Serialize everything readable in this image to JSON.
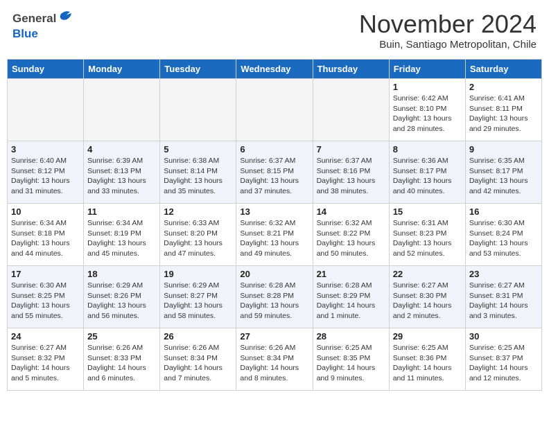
{
  "header": {
    "logo_general": "General",
    "logo_blue": "Blue",
    "month_title": "November 2024",
    "location": "Buin, Santiago Metropolitan, Chile"
  },
  "days_of_week": [
    "Sunday",
    "Monday",
    "Tuesday",
    "Wednesday",
    "Thursday",
    "Friday",
    "Saturday"
  ],
  "weeks": [
    {
      "row_class": "week-row-1",
      "days": [
        {
          "num": "",
          "info": "",
          "empty": true
        },
        {
          "num": "",
          "info": "",
          "empty": true
        },
        {
          "num": "",
          "info": "",
          "empty": true
        },
        {
          "num": "",
          "info": "",
          "empty": true
        },
        {
          "num": "",
          "info": "",
          "empty": true
        },
        {
          "num": "1",
          "info": "Sunrise: 6:42 AM\nSunset: 8:10 PM\nDaylight: 13 hours\nand 28 minutes.",
          "empty": false
        },
        {
          "num": "2",
          "info": "Sunrise: 6:41 AM\nSunset: 8:11 PM\nDaylight: 13 hours\nand 29 minutes.",
          "empty": false
        }
      ]
    },
    {
      "row_class": "week-row-2",
      "days": [
        {
          "num": "3",
          "info": "Sunrise: 6:40 AM\nSunset: 8:12 PM\nDaylight: 13 hours\nand 31 minutes.",
          "empty": false
        },
        {
          "num": "4",
          "info": "Sunrise: 6:39 AM\nSunset: 8:13 PM\nDaylight: 13 hours\nand 33 minutes.",
          "empty": false
        },
        {
          "num": "5",
          "info": "Sunrise: 6:38 AM\nSunset: 8:14 PM\nDaylight: 13 hours\nand 35 minutes.",
          "empty": false
        },
        {
          "num": "6",
          "info": "Sunrise: 6:37 AM\nSunset: 8:15 PM\nDaylight: 13 hours\nand 37 minutes.",
          "empty": false
        },
        {
          "num": "7",
          "info": "Sunrise: 6:37 AM\nSunset: 8:16 PM\nDaylight: 13 hours\nand 38 minutes.",
          "empty": false
        },
        {
          "num": "8",
          "info": "Sunrise: 6:36 AM\nSunset: 8:17 PM\nDaylight: 13 hours\nand 40 minutes.",
          "empty": false
        },
        {
          "num": "9",
          "info": "Sunrise: 6:35 AM\nSunset: 8:17 PM\nDaylight: 13 hours\nand 42 minutes.",
          "empty": false
        }
      ]
    },
    {
      "row_class": "week-row-3",
      "days": [
        {
          "num": "10",
          "info": "Sunrise: 6:34 AM\nSunset: 8:18 PM\nDaylight: 13 hours\nand 44 minutes.",
          "empty": false
        },
        {
          "num": "11",
          "info": "Sunrise: 6:34 AM\nSunset: 8:19 PM\nDaylight: 13 hours\nand 45 minutes.",
          "empty": false
        },
        {
          "num": "12",
          "info": "Sunrise: 6:33 AM\nSunset: 8:20 PM\nDaylight: 13 hours\nand 47 minutes.",
          "empty": false
        },
        {
          "num": "13",
          "info": "Sunrise: 6:32 AM\nSunset: 8:21 PM\nDaylight: 13 hours\nand 49 minutes.",
          "empty": false
        },
        {
          "num": "14",
          "info": "Sunrise: 6:32 AM\nSunset: 8:22 PM\nDaylight: 13 hours\nand 50 minutes.",
          "empty": false
        },
        {
          "num": "15",
          "info": "Sunrise: 6:31 AM\nSunset: 8:23 PM\nDaylight: 13 hours\nand 52 minutes.",
          "empty": false
        },
        {
          "num": "16",
          "info": "Sunrise: 6:30 AM\nSunset: 8:24 PM\nDaylight: 13 hours\nand 53 minutes.",
          "empty": false
        }
      ]
    },
    {
      "row_class": "week-row-4",
      "days": [
        {
          "num": "17",
          "info": "Sunrise: 6:30 AM\nSunset: 8:25 PM\nDaylight: 13 hours\nand 55 minutes.",
          "empty": false
        },
        {
          "num": "18",
          "info": "Sunrise: 6:29 AM\nSunset: 8:26 PM\nDaylight: 13 hours\nand 56 minutes.",
          "empty": false
        },
        {
          "num": "19",
          "info": "Sunrise: 6:29 AM\nSunset: 8:27 PM\nDaylight: 13 hours\nand 58 minutes.",
          "empty": false
        },
        {
          "num": "20",
          "info": "Sunrise: 6:28 AM\nSunset: 8:28 PM\nDaylight: 13 hours\nand 59 minutes.",
          "empty": false
        },
        {
          "num": "21",
          "info": "Sunrise: 6:28 AM\nSunset: 8:29 PM\nDaylight: 14 hours\nand 1 minute.",
          "empty": false
        },
        {
          "num": "22",
          "info": "Sunrise: 6:27 AM\nSunset: 8:30 PM\nDaylight: 14 hours\nand 2 minutes.",
          "empty": false
        },
        {
          "num": "23",
          "info": "Sunrise: 6:27 AM\nSunset: 8:31 PM\nDaylight: 14 hours\nand 3 minutes.",
          "empty": false
        }
      ]
    },
    {
      "row_class": "week-row-5",
      "days": [
        {
          "num": "24",
          "info": "Sunrise: 6:27 AM\nSunset: 8:32 PM\nDaylight: 14 hours\nand 5 minutes.",
          "empty": false
        },
        {
          "num": "25",
          "info": "Sunrise: 6:26 AM\nSunset: 8:33 PM\nDaylight: 14 hours\nand 6 minutes.",
          "empty": false
        },
        {
          "num": "26",
          "info": "Sunrise: 6:26 AM\nSunset: 8:34 PM\nDaylight: 14 hours\nand 7 minutes.",
          "empty": false
        },
        {
          "num": "27",
          "info": "Sunrise: 6:26 AM\nSunset: 8:34 PM\nDaylight: 14 hours\nand 8 minutes.",
          "empty": false
        },
        {
          "num": "28",
          "info": "Sunrise: 6:25 AM\nSunset: 8:35 PM\nDaylight: 14 hours\nand 9 minutes.",
          "empty": false
        },
        {
          "num": "29",
          "info": "Sunrise: 6:25 AM\nSunset: 8:36 PM\nDaylight: 14 hours\nand 11 minutes.",
          "empty": false
        },
        {
          "num": "30",
          "info": "Sunrise: 6:25 AM\nSunset: 8:37 PM\nDaylight: 14 hours\nand 12 minutes.",
          "empty": false
        }
      ]
    }
  ]
}
